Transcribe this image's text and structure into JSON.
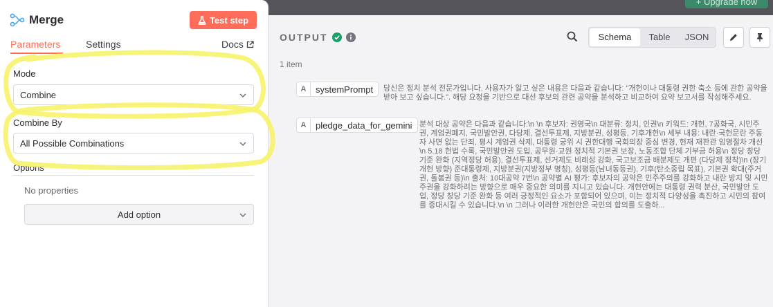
{
  "topbar": {
    "upgrade_label": "+ Upgrade now"
  },
  "node": {
    "title": "Merge",
    "icon": "merge-node-icon",
    "test_step_label": "Test step",
    "test_step_icon": "flask-icon"
  },
  "tabs": {
    "parameters": "Parameters",
    "settings": "Settings",
    "docs": "Docs"
  },
  "params": {
    "mode_label": "Mode",
    "mode_value": "Combine",
    "combine_by_label": "Combine By",
    "combine_by_value": "All Possible Combinations",
    "options_label": "Options",
    "no_properties": "No properties",
    "add_option_label": "Add option"
  },
  "output": {
    "title": "OUTPUT",
    "items_count": "1 item",
    "views": [
      "Schema",
      "Table",
      "JSON"
    ],
    "selected_view": "Schema",
    "fields": [
      {
        "type": "A",
        "key": "systemPrompt",
        "value": "당신은 정치 분석 전문가입니다. 사용자가 알고 싶은 내용은 다음과 같습니다: \"개헌이나 대통령 권한 축소 등에 관한 공약을 받아 보고 싶습니다.\". 해당 요청을 기반으로 대선 후보의 관련 공약을 분석하고 비교하여 요약 보고서를 작성해주세요."
      },
      {
        "type": "A",
        "key": "pledge_data_for_gemini",
        "value": "분석 대상 공약은 다음과 같습니다:\\n \\n 후보자: 권영국\\n 대분류: 정치, 인권\\n 키워드: 개헌, 7공화국, 시민주권, 계엄권폐지, 국민발안권, 다당제, 결선투표제, 지방분권, 성평등, 기후개헌\\n 세부 내용: 내란·국헌문란 주동자 사면 없는 단죄, 평시 계엄권 삭제, 대통령 궁위 시 권한대행 국회의장 중심 변경, 현재 재판관 임명절차 개선\\n 5.18 헌법 수록, 국민발안권 도입, 공무원·교원 정치적 기본권 보장, 노동조합 단체 기부금 허용\\n 정당 창당 기준 완화 (지역정당 허용), 결선투표제, 선거제도 비례성 강화, 국고보조금 배분제도 개편 (다당제 정착)\\n (장기 개헌 방향) 준대통령제, 지방분권(지방정부 명칭), 성평등(남녀동등권), 기후(탄소중립 목표), 기본권 확대(주거권, 돌봄권 등)\\n 출처: 10대공약 7번\\n 공약별 AI 평가: 후보자의 공약은 민주주의를 강화하고 내란 방지 및 시민주권을 강화하려는 방향으로 매우 중요한 의미를 지니고 있습니다. 개헌안에는 대통령 권력 분산, 국민발안 도입, 정당 창당 기준 완화 등 여러 긍정적인 요소가 포함되어 있으며, 이는 정치적 다양성을 촉진하고 시민의 참여를 증대시킬 수 있습니다.\\n \\n 그러나 이러한 개헌안은 국민의 합의를 도출하..."
      }
    ]
  },
  "colors": {
    "accent": "#ff6d5a",
    "success": "#1a9e6a",
    "highlight": "#f7f36a"
  }
}
